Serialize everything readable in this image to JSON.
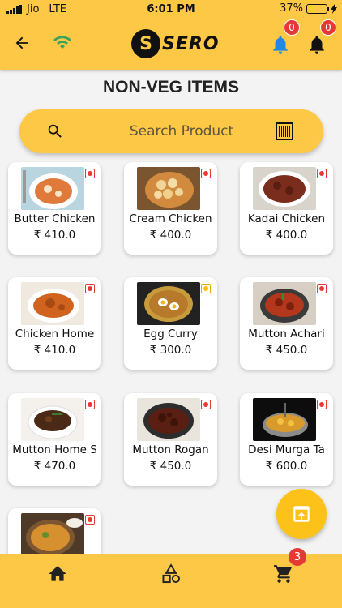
{
  "status_bar": {
    "carrier": "Jio",
    "network": "LTE",
    "time": "6:01 PM",
    "battery": "37%",
    "battery_level": 0.37
  },
  "header": {
    "logo_text": "SERO",
    "logo_letter": "S",
    "badge_a": "0",
    "badge_b": "0"
  },
  "page_title": "NON-VEG ITEMS",
  "search": {
    "placeholder": "Search Product"
  },
  "colors": {
    "primary": "#fdc845",
    "badge": "#e53935"
  },
  "products": [
    {
      "name": "Butter Chicken",
      "price": "₹ 410.0",
      "mark": "red"
    },
    {
      "name": "Cream Chicken",
      "price": "₹ 400.0",
      "mark": "red"
    },
    {
      "name": "Kadai Chicken",
      "price": "₹ 400.0",
      "mark": "red"
    },
    {
      "name": "Chicken Home",
      "price": "₹ 410.0",
      "mark": "red"
    },
    {
      "name": "Egg Curry",
      "price": "₹ 300.0",
      "mark": "yellow"
    },
    {
      "name": "Mutton Achari",
      "price": "₹ 450.0",
      "mark": "red"
    },
    {
      "name": "Mutton Home S",
      "price": "₹ 470.0",
      "mark": "red"
    },
    {
      "name": "Mutton Rogan",
      "price": "₹ 450.0",
      "mark": "red"
    },
    {
      "name": "Desi Murga Ta",
      "price": "₹ 600.0",
      "mark": "red"
    },
    {
      "name": "",
      "price": "",
      "mark": "red"
    }
  ],
  "bottom_nav": {
    "cart_count": "3",
    "icons": [
      "home-icon",
      "categories-icon",
      "cart-icon"
    ]
  }
}
